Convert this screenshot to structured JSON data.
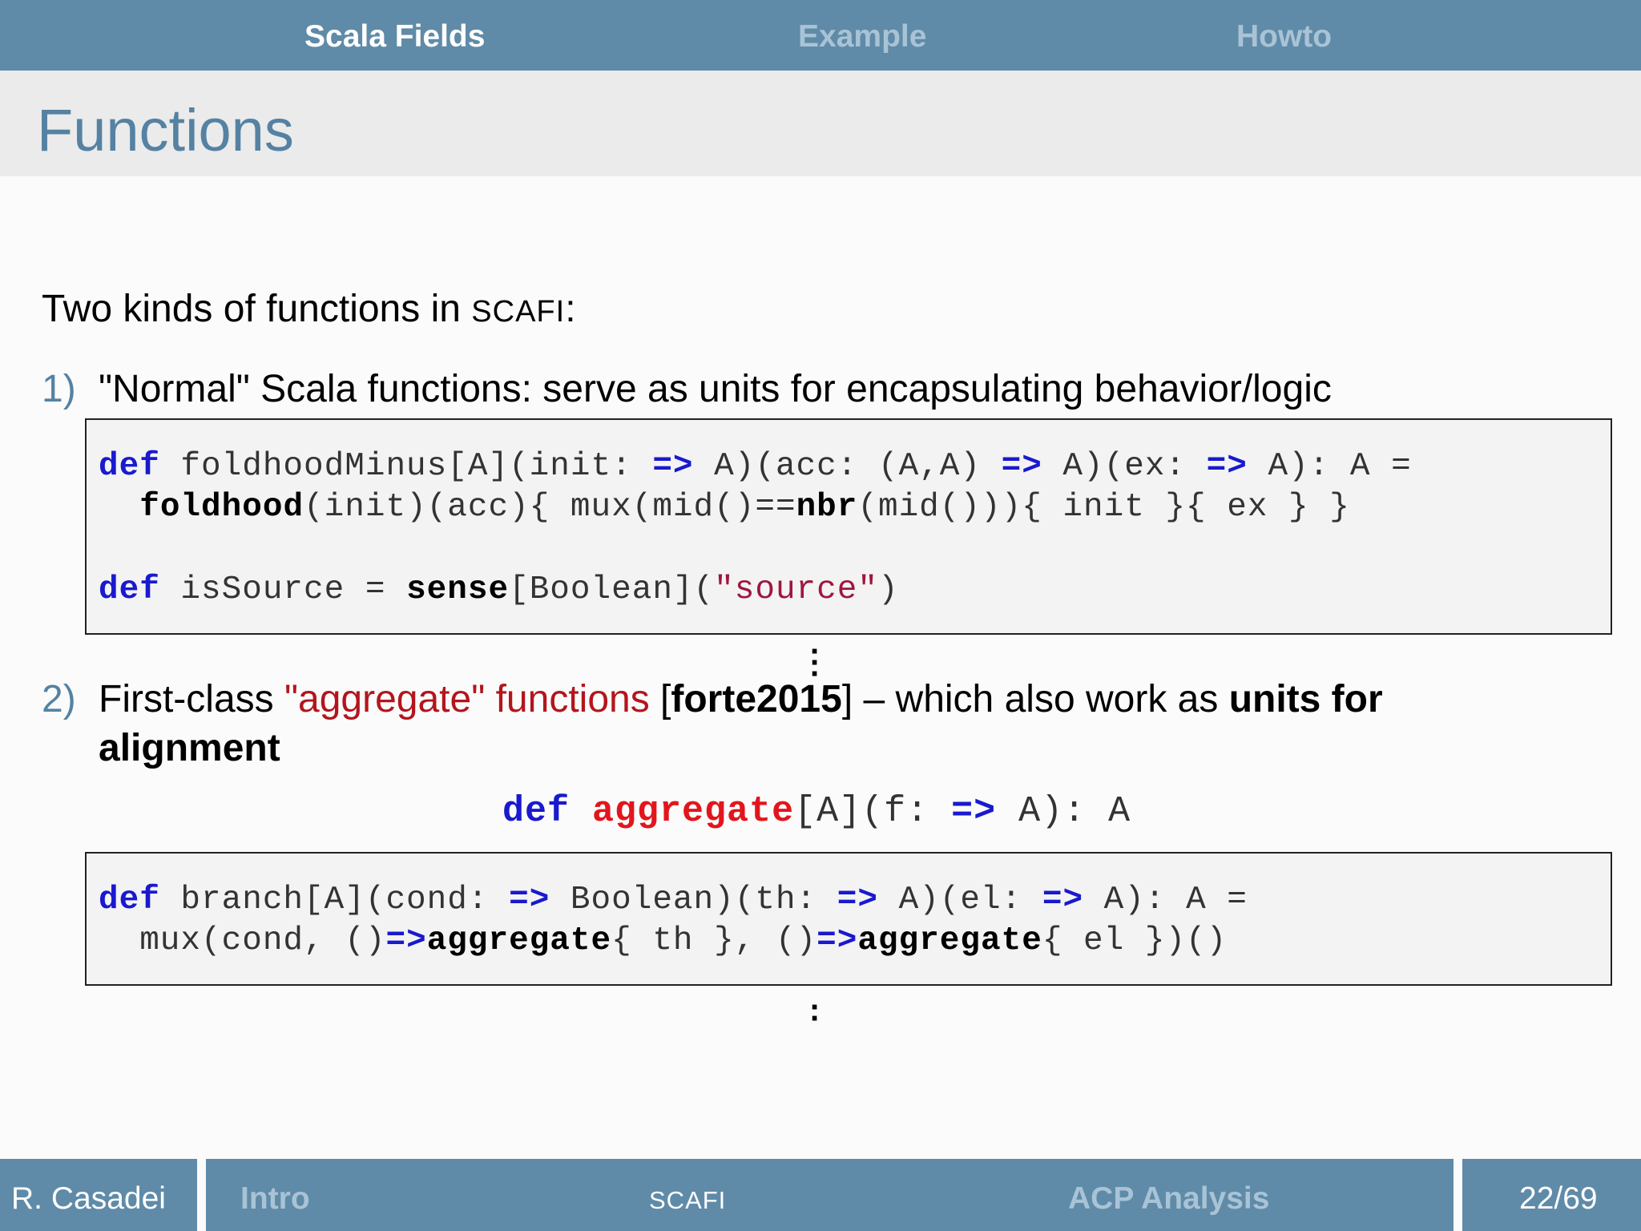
{
  "nav": {
    "item1": "Scala Fields",
    "item2": "Example",
    "item3": "Howto"
  },
  "frame_title": "Functions",
  "intro": {
    "text": "Two kinds of functions in ",
    "scafi": "SCAFI",
    "colon": ":"
  },
  "item1": {
    "number": "1)",
    "text": "\"Normal\" Scala functions: serve as units for encapsulating behavior/logic"
  },
  "code1": {
    "l1_def": "def",
    "l1_a": " foldhoodMinus[A](init: ",
    "l1_arrow1": "=>",
    "l1_b": " A)(acc: (A,A) ",
    "l1_arrow2": "=>",
    "l1_c": " A)(ex: ",
    "l1_arrow3": "=>",
    "l1_d": " A): A =",
    "l2_indent": "  ",
    "l2_foldhood": "foldhood",
    "l2_a": "(init)(acc){ mux(mid()==",
    "l2_nbr": "nbr",
    "l2_b": "(mid())){ init }{ ex } }",
    "l3_def": "def",
    "l3_a": " isSource = ",
    "l3_sense": "sense",
    "l3_b": "[Boolean](",
    "l3_str": "\"source\"",
    "l3_c": ")"
  },
  "item2": {
    "number": "2)",
    "t1": "First-class ",
    "t2": "\"aggregate\" functions",
    "t3": " [",
    "t4": "forte2015",
    "t5": "] – which also work as ",
    "t6": "units for",
    "t7": "alignment"
  },
  "signature": {
    "def": "def",
    "name": "aggregate",
    "a": "[A](f: ",
    "arrow": "=>",
    "b": " A): A"
  },
  "code2": {
    "l1_def": "def",
    "l1_a": " branch[A](cond: ",
    "l1_arrow1": "=>",
    "l1_b": " Boolean)(th: ",
    "l1_arrow2": "=>",
    "l1_c": " A)(el: ",
    "l1_arrow3": "=>",
    "l1_d": " A): A =",
    "l2_a": "  mux(cond, ()",
    "l2_arrow1": "=>",
    "l2_agg1": "aggregate",
    "l2_b": "{ th }, ()",
    "l2_arrow2": "=>",
    "l2_agg2": "aggregate",
    "l2_c": "{ el })()"
  },
  "footer": {
    "author": "R. Casadei",
    "sec1": "Intro",
    "sec2": "SCAFI",
    "sec3": "ACP Analysis",
    "page": "22/69"
  },
  "colors": {
    "bar": "#5f8ba8",
    "title": "#5582a2",
    "keyword": "#1919cf",
    "red": "#b3151c",
    "string": "#a0153e"
  }
}
